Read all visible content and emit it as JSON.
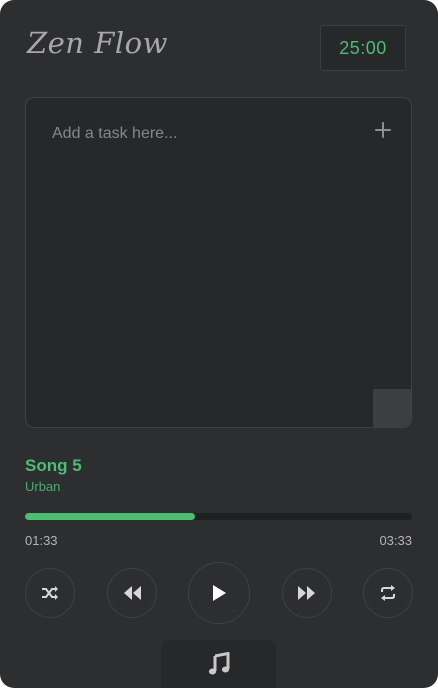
{
  "app": {
    "name": "Zen Flow"
  },
  "timer": {
    "display": "25:00"
  },
  "task": {
    "placeholder": "Add a task here...",
    "add_icon": "plus-icon"
  },
  "player": {
    "song_title": "Song 5",
    "artist": "Urban",
    "current_time": "01:33",
    "total_time": "03:33",
    "progress": 0.44,
    "controls": [
      "shuffle-icon",
      "rewind-icon",
      "play-icon",
      "fast-forward-icon",
      "repeat-icon"
    ]
  },
  "nav": {
    "active_tab_icon": "music-note-icon"
  },
  "colors": {
    "accent": "#4cbd72",
    "background": "#2d2e30",
    "panel": "#27282a",
    "border": "#404145",
    "muted_text": "#86878a"
  }
}
